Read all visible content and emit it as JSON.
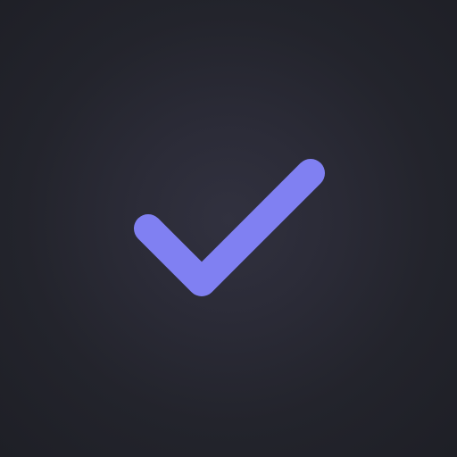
{
  "icon": {
    "name": "checkmark-icon",
    "color": "#8080f2"
  },
  "background": {
    "inner_color": "#31313f",
    "outer_color": "#1e1f26"
  }
}
